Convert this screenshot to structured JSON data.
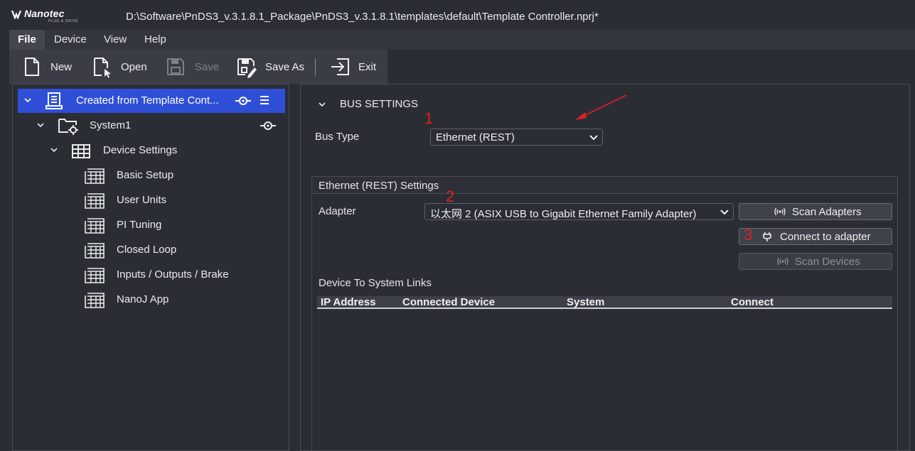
{
  "app": {
    "logo_text": "Nanotec",
    "logo_sub": "PLUG & DRIVE",
    "title": "D:\\Software\\PnDS3_v.3.1.8.1_Package\\PnDS3_v.3.1.8.1\\templates\\default\\Template Controller.nprj*"
  },
  "menu": [
    "File",
    "Device",
    "View",
    "Help"
  ],
  "toolbar": {
    "new": "New",
    "open": "Open",
    "save": "Save",
    "save_as": "Save As",
    "exit": "Exit"
  },
  "tree": {
    "root": "Created from Template Cont...",
    "system": "System1",
    "device_settings": "Device Settings",
    "items": [
      "Basic Setup",
      "User Units",
      "PI Tuning",
      "Closed Loop",
      "Inputs / Outputs / Brake",
      "NanoJ App"
    ]
  },
  "bus": {
    "section_title": "BUS SETTINGS",
    "bus_type_label": "Bus Type",
    "bus_type_value": "Ethernet (REST)",
    "group_title": "Ethernet (REST) Settings",
    "adapter_label": "Adapter",
    "adapter_value": "以太网 2 (ASIX USB to Gigabit Ethernet Family Adapter)",
    "scan_adapters": "Scan Adapters",
    "connect_adapter": "Connect to adapter",
    "scan_devices": "Scan Devices",
    "links_title": "Device To System Links",
    "columns": [
      "IP Address",
      "Connected Device",
      "System",
      "Connect"
    ]
  },
  "annotations": [
    "1",
    "2",
    "3"
  ],
  "colors": {
    "selected": "#2e4fd6",
    "annotation": "#e02020"
  }
}
